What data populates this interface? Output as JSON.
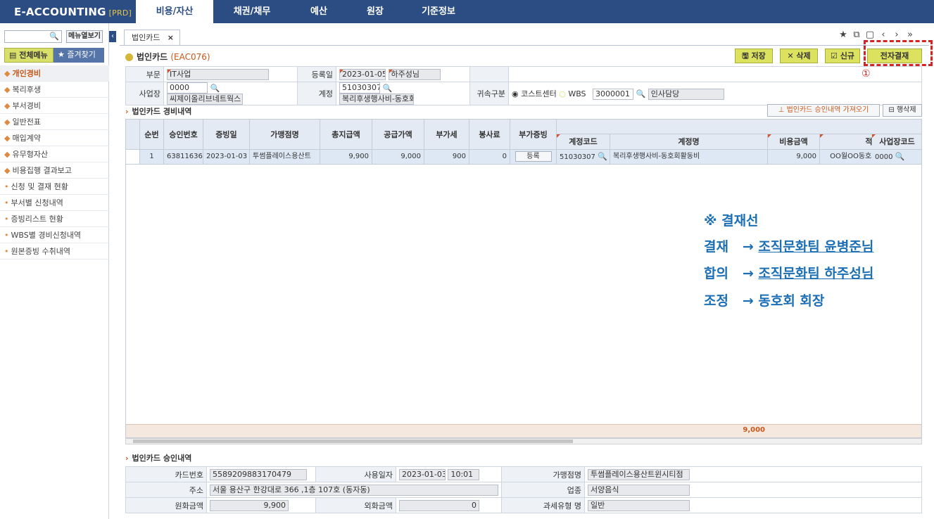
{
  "app": {
    "name": "E-ACCOUNTING",
    "env": "[PRD]"
  },
  "top_menu": [
    "비용/자산",
    "채권/채무",
    "예산",
    "원장",
    "기준정보"
  ],
  "sidebar": {
    "search_placeholder": "",
    "menu_view_label": "메뉴열보기",
    "all_menu_label": "전체메뉴",
    "favorites_label": "즐겨찾기",
    "items": [
      {
        "label": "개인경비",
        "mark": "◆"
      },
      {
        "label": "복리후생",
        "mark": "◆"
      },
      {
        "label": "부서경비",
        "mark": "◆"
      },
      {
        "label": "일반전표",
        "mark": "◆"
      },
      {
        "label": "매입계약",
        "mark": "◆"
      },
      {
        "label": "유무형자산",
        "mark": "◆"
      },
      {
        "label": "비용집행 결과보고",
        "mark": "◆"
      },
      {
        "label": "신청 및 결재 현황",
        "mark": "•"
      },
      {
        "label": "부서별 신청내역",
        "mark": "•"
      },
      {
        "label": "증빙리스트 현황",
        "mark": "•"
      },
      {
        "label": "WBS별 경비신청내역",
        "mark": "•"
      },
      {
        "label": "원본증빙 수취내역",
        "mark": "•"
      }
    ]
  },
  "tab": {
    "label": "법인카드",
    "close": "×"
  },
  "toolbar_icons": [
    "★",
    "⧉",
    "▢",
    "‹",
    "›",
    "»"
  ],
  "page": {
    "title": "법인카드",
    "code": "(EAC076)"
  },
  "buttons": {
    "save": "저장",
    "delete": "삭제",
    "new": "신규",
    "eapproval": "전자결재"
  },
  "annotation_number": "①",
  "header_form": {
    "dept_label": "부문",
    "dept_value": "IT사업",
    "reg_date_label": "등록일",
    "reg_date_value": "2023-01-05",
    "registrant": "하주성님",
    "site_label": "사업장",
    "site_code": "0000",
    "site_name": "씨제이올리브네트웍스",
    "account_label": "계정",
    "account_code": "51030307",
    "account_name": "복리후생행사비-동호회",
    "attr_label": "귀속구분",
    "cost_center_label": "코스트센터",
    "wbs_label": "WBS",
    "cc_code": "3000001",
    "cc_name": "인사담당"
  },
  "expense_section": {
    "title": "법인카드 경비내역",
    "import_button": "법인카드 승인내역 가져오기",
    "row_delete_button": "행삭제",
    "columns": [
      "순번",
      "승인번호",
      "증빙일",
      "가맹점명",
      "총지급액",
      "공급가액",
      "부가세",
      "봉사료",
      "부가증빙",
      "계정코드",
      "계정명",
      "비용금액",
      "적요",
      "사업장코드"
    ],
    "rows": [
      {
        "seq": "1",
        "approval_no": "63811636",
        "date": "2023-01-03",
        "merchant": "투썸플레이스용산트",
        "total": "9,900",
        "supply": "9,000",
        "vat": "900",
        "service": "0",
        "evidence_btn": "등록",
        "account_code": "51030307",
        "account_name": "복리후생행사비-동호회활동비",
        "cost": "9,000",
        "memo": "OO월OO동호회 활동비 정산",
        "site_code": "0000"
      }
    ],
    "total_cost": "9,000"
  },
  "approval_line": {
    "heading": "※ 결재선",
    "lines": [
      {
        "type": "결재",
        "arrow": "→",
        "target": "조직문화팀 윤병준님"
      },
      {
        "type": "합의",
        "arrow": "→",
        "target": "조직문화팀 하주성님"
      },
      {
        "type": "조정",
        "arrow": "→",
        "target": "동호회 회장"
      }
    ]
  },
  "approval_detail": {
    "title": "법인카드 승인내역",
    "card_no_label": "카드번호",
    "card_no": "5589209883170479",
    "use_date_label": "사용일자",
    "use_date": "2023-01-03",
    "use_time": "10:01",
    "merchant_label": "가맹점명",
    "merchant": "투썸플레이스용산트윈시티점",
    "address_label": "주소",
    "address": "서울 용산구 한강대로 366 ,1층 107호 (동자동)",
    "business_label": "업종",
    "business": "서양음식",
    "krw_label": "원화금액",
    "krw": "9,900",
    "foreign_label": "외화금액",
    "foreign": "0",
    "tax_type_label": "과세유형 명",
    "tax_type": "일반"
  }
}
